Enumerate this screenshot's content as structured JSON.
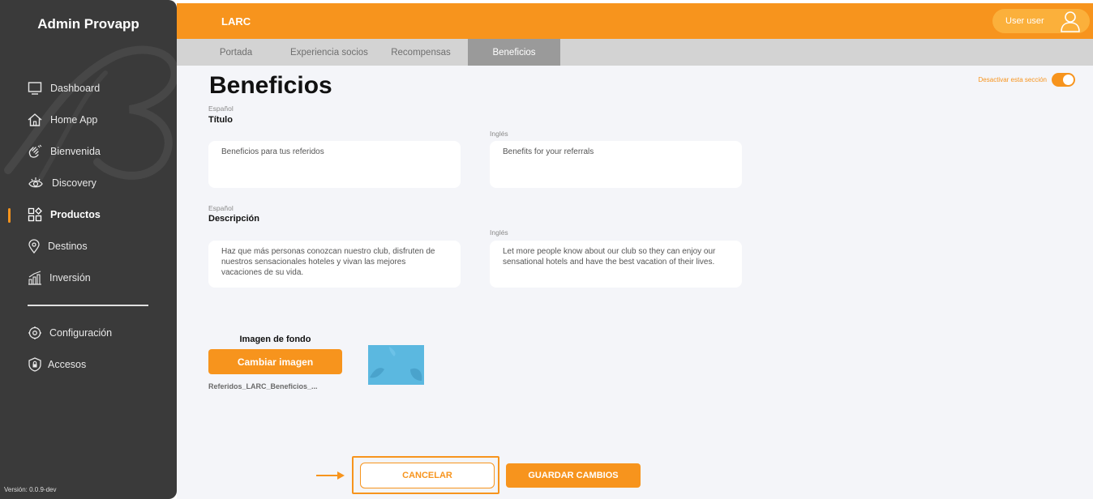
{
  "sidebar": {
    "brand": "Admin Provapp",
    "items": [
      {
        "label": "Dashboard",
        "icon": "monitor-icon"
      },
      {
        "label": "Home App",
        "icon": "home-icon"
      },
      {
        "label": "Bienvenida",
        "icon": "waving-hand-icon"
      },
      {
        "label": "Discovery",
        "icon": "eye-icon"
      },
      {
        "label": "Productos",
        "icon": "grid-icon",
        "active": true
      },
      {
        "label": "Destinos",
        "icon": "map-pin-icon"
      },
      {
        "label": "Inversión",
        "icon": "bar-chart-icon"
      }
    ],
    "bottom_items": [
      {
        "label": "Configuración",
        "icon": "gear-icon"
      },
      {
        "label": "Accesos",
        "icon": "shield-lock-icon"
      }
    ],
    "version": "Versión: 0.0.9-dev"
  },
  "header": {
    "org": "LARC",
    "user_name": "User user"
  },
  "tabs": [
    {
      "label": "Portada"
    },
    {
      "label": "Experiencia socios"
    },
    {
      "label": "Recompensas"
    },
    {
      "label": "Beneficios",
      "active": true
    }
  ],
  "main": {
    "title": "Beneficios",
    "section_toggle_label": "Desactivar esta sección",
    "section_toggle_on": true,
    "titulo": {
      "lang_es": "Español",
      "heading": "Título",
      "value_es": "Beneficios para tus referidos",
      "lang_en": "Inglés",
      "value_en": "Benefits for your referrals"
    },
    "descripcion": {
      "lang_es": "Español",
      "heading": "Descripción",
      "value_es": "Haz que más personas conozcan nuestro club, disfruten de nuestros sensacionales hoteles y vivan las mejores vacaciones de su vida.",
      "lang_en": "Inglés",
      "value_en": "Let more people know about our club so they can enjoy our sensational hotels and have the best vacation of their lives."
    },
    "background_image": {
      "label": "Imagen de fondo",
      "button": "Cambiar imagen",
      "filename": "Referidos_LARC_Beneficios_..."
    },
    "actions": {
      "cancel": "CANCELAR",
      "save": "GUARDAR CAMBIOS"
    }
  },
  "colors": {
    "accent": "#f7941d",
    "sidebar_bg": "#3a3a3a",
    "content_bg": "#f4f5f9"
  }
}
